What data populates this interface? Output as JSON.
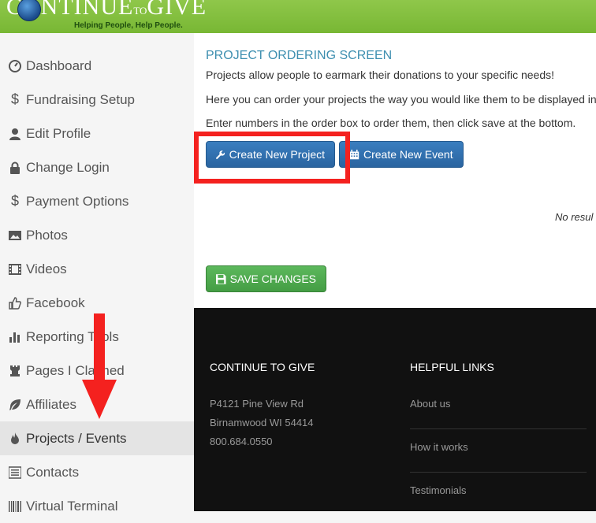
{
  "header": {
    "logo_main_left": "CONTINUE",
    "logo_main_small": "TO",
    "logo_main_right": "GIVE",
    "tagline": "Helping People, Help People."
  },
  "sidebar": {
    "items": [
      {
        "label": "Dashboard",
        "icon": "dashboard-icon"
      },
      {
        "label": "Fundraising Setup",
        "icon": "dollar-icon"
      },
      {
        "label": "Edit Profile",
        "icon": "user-icon"
      },
      {
        "label": "Change Login",
        "icon": "lock-icon"
      },
      {
        "label": "Payment Options",
        "icon": "dollar-icon"
      },
      {
        "label": "Photos",
        "icon": "photo-icon"
      },
      {
        "label": "Videos",
        "icon": "film-icon"
      },
      {
        "label": "Facebook",
        "icon": "thumbs-up-icon"
      },
      {
        "label": "Reporting Tools",
        "icon": "bar-chart-icon"
      },
      {
        "label": "Pages I Claimed",
        "icon": "rook-icon"
      },
      {
        "label": "Affiliates",
        "icon": "leaf-icon"
      },
      {
        "label": "Projects / Events",
        "icon": "fire-icon",
        "active": true
      },
      {
        "label": "Contacts",
        "icon": "list-icon"
      },
      {
        "label": "Virtual Terminal",
        "icon": "barcode-icon"
      }
    ]
  },
  "main": {
    "title": "PROJECT ORDERING SCREEN",
    "line1": "Projects allow people to earmark their donations to your specific needs!",
    "line2": "Here you can order your projects the way you would like them to be displayed in",
    "line3": "Enter numbers in the order box to order them, then click save at the bottom.",
    "create_project_label": "Create New Project",
    "create_event_label": "Create New Event",
    "no_results": "No resul",
    "save_label": "SAVE CHANGES"
  },
  "footer": {
    "col1_title": "CONTINUE TO GIVE",
    "address1": "P4121 Pine View Rd",
    "address2": "Birnamwood WI 54414",
    "phone": "800.684.0550",
    "col2_title": "HELPFUL LINKS",
    "links": [
      "About us",
      "How it works",
      "Testimonials"
    ]
  },
  "colors": {
    "header_green": "#7dbb3a",
    "title_blue": "#3e8fb0",
    "button_blue": "#2a64a0",
    "button_green": "#449d44",
    "highlight_red": "#f4211f",
    "footer_bg": "#111111"
  }
}
